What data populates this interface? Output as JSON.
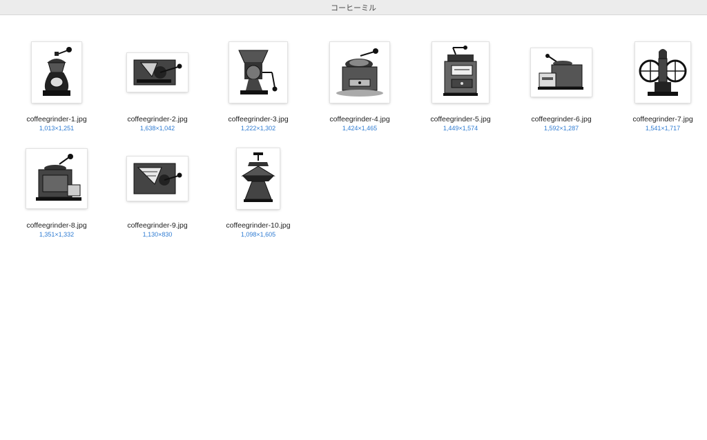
{
  "window": {
    "title": "コーヒーミル"
  },
  "files": [
    {
      "name": "coffeegrinder-1.jpg",
      "dimensions": "1,013×1,251",
      "icon": "coffee-grinder-tall-icon"
    },
    {
      "name": "coffeegrinder-2.jpg",
      "dimensions": "1,638×1,042",
      "icon": "coffee-grinder-wall-icon"
    },
    {
      "name": "coffeegrinder-3.jpg",
      "dimensions": "1,222×1,302",
      "icon": "coffee-grinder-hopper-icon"
    },
    {
      "name": "coffeegrinder-4.jpg",
      "dimensions": "1,424×1,465",
      "icon": "coffee-grinder-box-icon"
    },
    {
      "name": "coffeegrinder-5.jpg",
      "dimensions": "1,449×1,574",
      "icon": "coffee-grinder-cabinet-icon"
    },
    {
      "name": "coffeegrinder-6.jpg",
      "dimensions": "1,592×1,287",
      "icon": "coffee-grinder-drawer-icon"
    },
    {
      "name": "coffeegrinder-7.jpg",
      "dimensions": "1,541×1,717",
      "icon": "coffee-grinder-wheel-icon"
    },
    {
      "name": "coffeegrinder-8.jpg",
      "dimensions": "1,351×1,332",
      "icon": "coffee-grinder-box-icon"
    },
    {
      "name": "coffeegrinder-9.jpg",
      "dimensions": "1,130×830",
      "icon": "coffee-grinder-wall-icon"
    },
    {
      "name": "coffeegrinder-10.jpg",
      "dimensions": "1,098×1,605",
      "icon": "coffee-grinder-cone-icon"
    }
  ]
}
